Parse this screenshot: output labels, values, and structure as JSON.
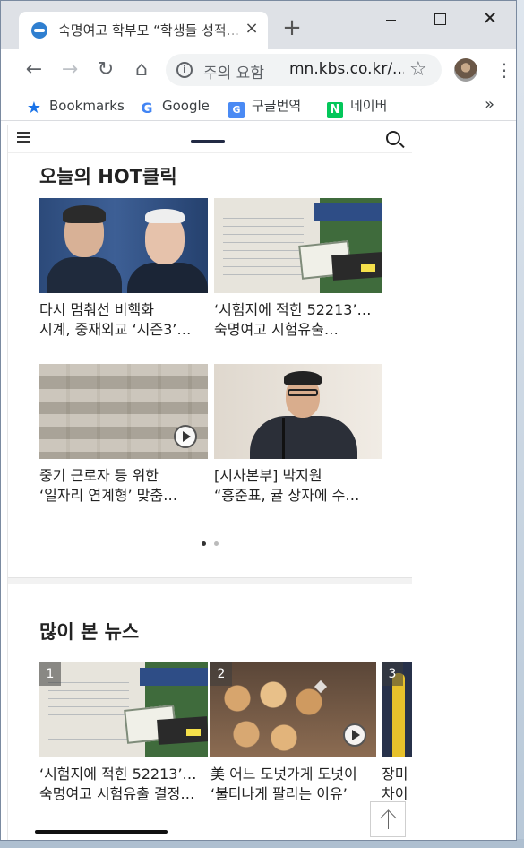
{
  "browser": {
    "tab_title": "숙명여고 학부모 “학생들 성적…",
    "tab_close": "×",
    "new_tab": "+",
    "window_close": "✕",
    "security_warning": "주의 요함",
    "url": "mn.kbs.co.kr/...",
    "menu": "⋮"
  },
  "bookmarks": [
    {
      "label": "Bookmarks",
      "icon": "star-icon"
    },
    {
      "label": "Google",
      "icon": "google-icon"
    },
    {
      "label": "구글번역",
      "icon": "translate-icon"
    },
    {
      "label": "네이버",
      "icon": "naver-icon"
    }
  ],
  "bookmarks_more": "»",
  "page": {
    "hot_title": "오늘의 HOT클릭",
    "hot_items": [
      {
        "line1": "다시 멈춰선 비핵화",
        "line2": "시계, 중재외교 ‘시즌3’…",
        "video": false
      },
      {
        "line1": "‘시험지에 적힌 52213’…",
        "line2": "숙명여고 시험유출…",
        "video": false
      },
      {
        "line1": "중기 근로자 등 위한",
        "line2": "‘일자리 연계형’ 맞춤…",
        "video": true
      },
      {
        "line1": "[시사본부] 박지원",
        "line2": "“홍준표, 귤 상자에 수…",
        "video": false
      }
    ],
    "carousel_pages": 2,
    "carousel_active": 1,
    "popular_title": "많이 본 뉴스",
    "popular_items": [
      {
        "rank": "1",
        "line1": "‘시험지에 적힌 52213’…",
        "line2": "숙명여고 시험유출 결정…",
        "video": false
      },
      {
        "rank": "2",
        "line1": "美 어느 도넛가게 도넛이",
        "line2": "‘불티나게 팔리는 이유’",
        "video": true
      },
      {
        "rank": "3",
        "line1": "장미",
        "line2": "차이",
        "video": false
      }
    ]
  },
  "colors": {
    "tabstrip": "#dee1e6",
    "accent": "#1a73e8",
    "naver": "#03c75a"
  }
}
